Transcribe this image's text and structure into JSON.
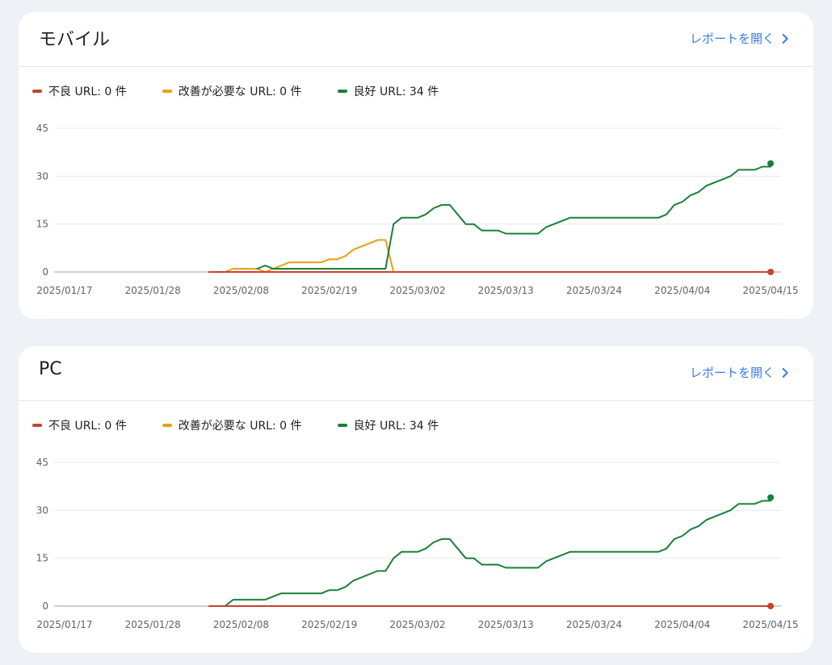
{
  "cards": [
    {
      "title": "モバイル",
      "report_link": "レポートを開く",
      "link_icon": "chevron-right-icon",
      "legend": [
        {
          "label": "不良 URL: 0 件",
          "color": "#c5432e"
        },
        {
          "label": "改善が必要な URL: 0 件",
          "color": "#e8a012"
        },
        {
          "label": "良好 URL: 34 件",
          "color": "#188038"
        }
      ]
    },
    {
      "title": "PC",
      "report_link": "レポートを開く",
      "link_icon": "chevron-right-icon",
      "legend": [
        {
          "label": "不良 URL: 0 件",
          "color": "#c5432e"
        },
        {
          "label": "改善が必要な URL: 0 件",
          "color": "#e8a012"
        },
        {
          "label": "良好 URL: 34 件",
          "color": "#188038"
        }
      ]
    }
  ],
  "chart_data": [
    {
      "type": "line",
      "x_tick_labels": [
        "2025/01/17",
        "2025/01/28",
        "2025/02/08",
        "2025/02/19",
        "2025/03/02",
        "2025/03/13",
        "2025/03/24",
        "2025/04/04",
        "2025/04/15"
      ],
      "y_ticks": [
        0,
        15,
        30,
        45
      ],
      "ylim": [
        0,
        45
      ],
      "xlim": [
        "2025/01/17",
        "2025/04/15"
      ],
      "grid": true,
      "legend_position": "top-left",
      "series": [
        {
          "name": "不良 URL",
          "color": "#c5432e",
          "points": [
            [
              "2025/02/04",
              0
            ],
            [
              "2025/04/15",
              0
            ]
          ]
        },
        {
          "name": "改善が必要な URL",
          "color": "#e8a012",
          "points": [
            [
              "2025/02/04",
              0
            ],
            [
              "2025/02/06",
              0
            ],
            [
              "2025/02/07",
              1
            ],
            [
              "2025/02/09",
              1
            ],
            [
              "2025/02/10",
              1
            ],
            [
              "2025/02/11",
              0
            ],
            [
              "2025/02/12",
              1
            ],
            [
              "2025/02/13",
              2
            ],
            [
              "2025/02/14",
              3
            ],
            [
              "2025/02/18",
              3
            ],
            [
              "2025/02/19",
              4
            ],
            [
              "2025/02/20",
              4
            ],
            [
              "2025/02/21",
              5
            ],
            [
              "2025/02/22",
              7
            ],
            [
              "2025/02/24",
              9
            ],
            [
              "2025/02/25",
              10
            ],
            [
              "2025/02/26",
              10
            ],
            [
              "2025/02/27",
              0
            ],
            [
              "2025/04/15",
              0
            ]
          ]
        },
        {
          "name": "良好 URL",
          "color": "#188038",
          "points": [
            [
              "2025/02/10",
              1
            ],
            [
              "2025/02/11",
              2
            ],
            [
              "2025/02/12",
              1
            ],
            [
              "2025/02/26",
              1
            ],
            [
              "2025/02/27",
              15
            ],
            [
              "2025/02/28",
              17
            ],
            [
              "2025/03/02",
              17
            ],
            [
              "2025/03/03",
              18
            ],
            [
              "2025/03/04",
              20
            ],
            [
              "2025/03/05",
              21
            ],
            [
              "2025/03/06",
              21
            ],
            [
              "2025/03/08",
              15
            ],
            [
              "2025/03/09",
              15
            ],
            [
              "2025/03/10",
              13
            ],
            [
              "2025/03/12",
              13
            ],
            [
              "2025/03/13",
              12
            ],
            [
              "2025/03/17",
              12
            ],
            [
              "2025/03/18",
              14
            ],
            [
              "2025/03/21",
              17
            ],
            [
              "2025/04/01",
              17
            ],
            [
              "2025/04/02",
              18
            ],
            [
              "2025/04/03",
              21
            ],
            [
              "2025/04/04",
              22
            ],
            [
              "2025/04/05",
              24
            ],
            [
              "2025/04/06",
              25
            ],
            [
              "2025/04/07",
              27
            ],
            [
              "2025/04/10",
              30
            ],
            [
              "2025/04/11",
              32
            ],
            [
              "2025/04/13",
              32
            ],
            [
              "2025/04/14",
              33
            ],
            [
              "2025/04/15",
              33
            ],
            [
              "2025/04/15",
              34
            ]
          ]
        }
      ]
    },
    {
      "type": "line",
      "x_tick_labels": [
        "2025/01/17",
        "2025/01/28",
        "2025/02/08",
        "2025/02/19",
        "2025/03/02",
        "2025/03/13",
        "2025/03/24",
        "2025/04/04",
        "2025/04/15"
      ],
      "y_ticks": [
        0,
        15,
        30,
        45
      ],
      "ylim": [
        0,
        45
      ],
      "xlim": [
        "2025/01/17",
        "2025/04/15"
      ],
      "grid": true,
      "legend_position": "top-left",
      "series": [
        {
          "name": "不良 URL",
          "color": "#c5432e",
          "points": [
            [
              "2025/02/04",
              0
            ],
            [
              "2025/04/15",
              0
            ]
          ]
        },
        {
          "name": "改善が必要な URL",
          "color": "#e8a012",
          "points": []
        },
        {
          "name": "良好 URL",
          "color": "#188038",
          "points": [
            [
              "2025/02/06",
              0
            ],
            [
              "2025/02/07",
              2
            ],
            [
              "2025/02/11",
              2
            ],
            [
              "2025/02/13",
              4
            ],
            [
              "2025/02/18",
              4
            ],
            [
              "2025/02/19",
              5
            ],
            [
              "2025/02/20",
              5
            ],
            [
              "2025/02/21",
              6
            ],
            [
              "2025/02/22",
              8
            ],
            [
              "2025/02/25",
              11
            ],
            [
              "2025/02/26",
              11
            ],
            [
              "2025/02/27",
              15
            ],
            [
              "2025/02/28",
              17
            ],
            [
              "2025/03/02",
              17
            ],
            [
              "2025/03/03",
              18
            ],
            [
              "2025/03/04",
              20
            ],
            [
              "2025/03/05",
              21
            ],
            [
              "2025/03/06",
              21
            ],
            [
              "2025/03/08",
              15
            ],
            [
              "2025/03/09",
              15
            ],
            [
              "2025/03/10",
              13
            ],
            [
              "2025/03/12",
              13
            ],
            [
              "2025/03/13",
              12
            ],
            [
              "2025/03/17",
              12
            ],
            [
              "2025/03/18",
              14
            ],
            [
              "2025/03/21",
              17
            ],
            [
              "2025/04/01",
              17
            ],
            [
              "2025/04/02",
              18
            ],
            [
              "2025/04/03",
              21
            ],
            [
              "2025/04/04",
              22
            ],
            [
              "2025/04/05",
              24
            ],
            [
              "2025/04/06",
              25
            ],
            [
              "2025/04/07",
              27
            ],
            [
              "2025/04/10",
              30
            ],
            [
              "2025/04/11",
              32
            ],
            [
              "2025/04/13",
              32
            ],
            [
              "2025/04/14",
              33
            ],
            [
              "2025/04/15",
              33
            ],
            [
              "2025/04/15",
              34
            ]
          ]
        }
      ]
    }
  ]
}
